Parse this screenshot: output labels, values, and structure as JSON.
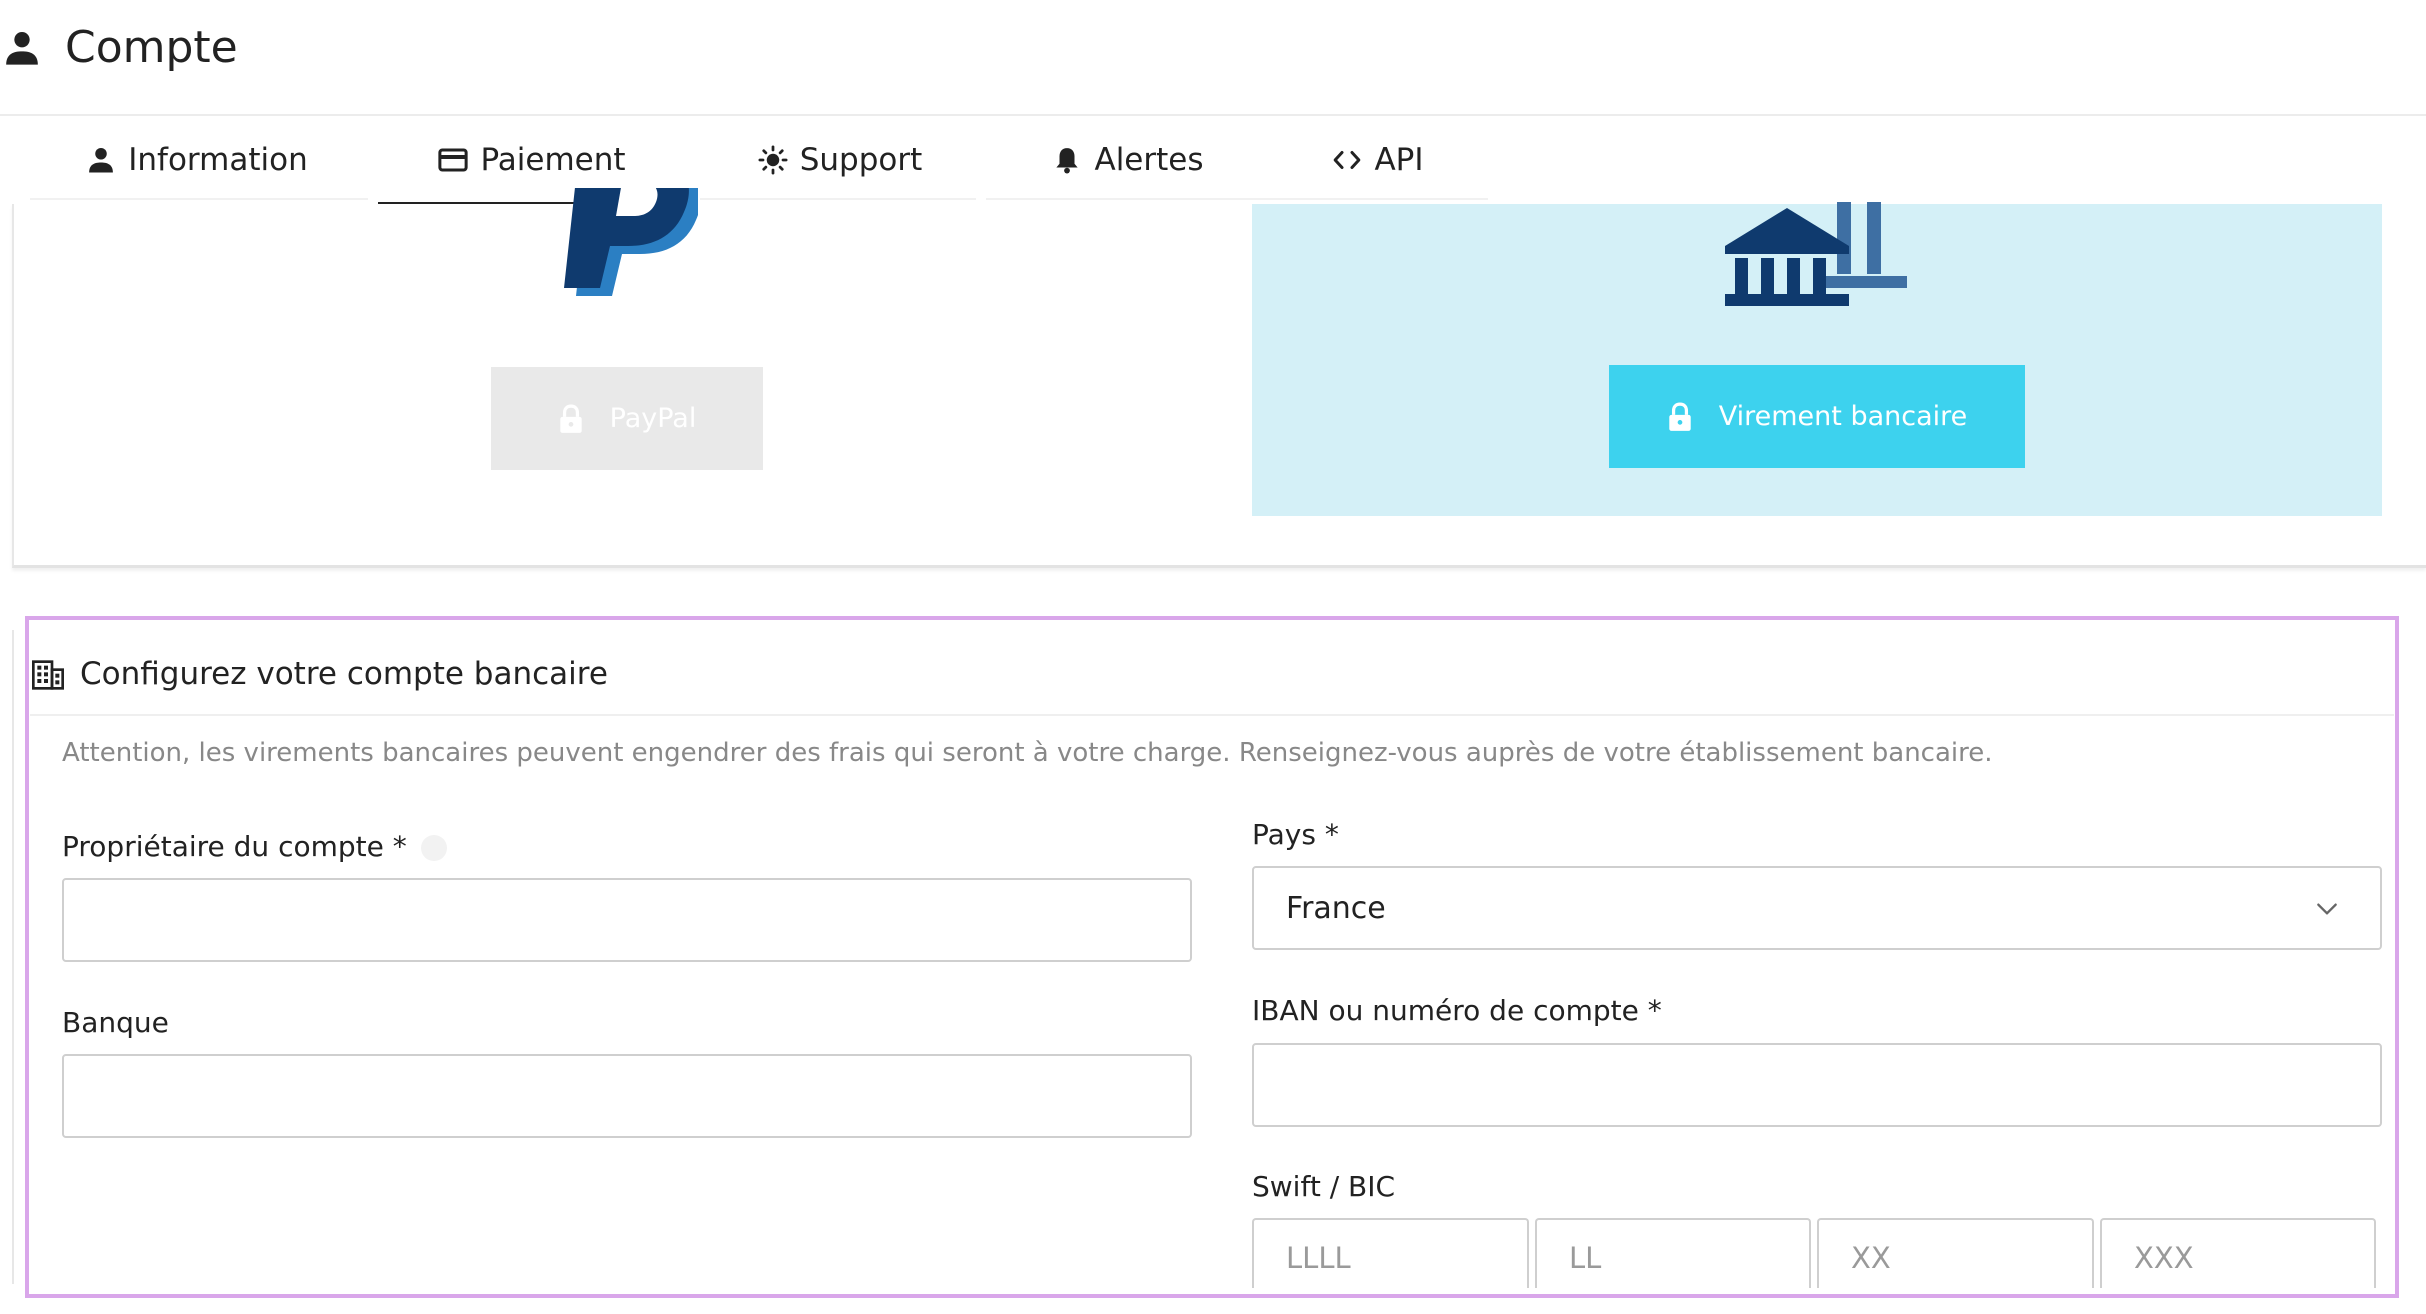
{
  "header": {
    "title": "Compte",
    "icon": "user-icon"
  },
  "tabs": [
    {
      "label": "Information",
      "icon": "user-icon",
      "active": false
    },
    {
      "label": "Paiement",
      "icon": "credit-card-icon",
      "active": true
    },
    {
      "label": "Support",
      "icon": "sun-icon",
      "active": false
    },
    {
      "label": "Alertes",
      "icon": "bell-icon",
      "active": false
    },
    {
      "label": "API",
      "icon": "code-icon",
      "active": false
    }
  ],
  "methods": {
    "paypal": {
      "label": "PayPal",
      "icon": "lock-icon",
      "state": "disabled"
    },
    "bank": {
      "label": "Virement bancaire",
      "icon": "lock-icon",
      "state": "selected"
    }
  },
  "config": {
    "title": "Configurez votre compte bancaire",
    "icon": "building-icon",
    "note": "Attention, les virements bancaires peuvent engendrer des frais qui seront à votre charge. Renseignez-vous auprès de votre établissement bancaire.",
    "fields": {
      "owner": {
        "label": "Propriétaire du compte *",
        "value": ""
      },
      "bank": {
        "label": "Banque",
        "value": ""
      },
      "country": {
        "label": "Pays *",
        "value": "France"
      },
      "iban": {
        "label": "IBAN ou numéro de compte *",
        "value": ""
      },
      "swift": {
        "label": "Swift / BIC",
        "placeholders": [
          "LLLL",
          "LL",
          "XX",
          "XXX"
        ]
      }
    }
  },
  "colors": {
    "accent": "#3dd2ee",
    "panel_selected": "#d4f0f7",
    "paypal_dark": "#0f3a6e",
    "paypal_light": "#2b7fc3",
    "bank_dark": "#0f3a6e",
    "bank_light": "#3e6fa3",
    "focus_frame": "#d9a6ea"
  }
}
